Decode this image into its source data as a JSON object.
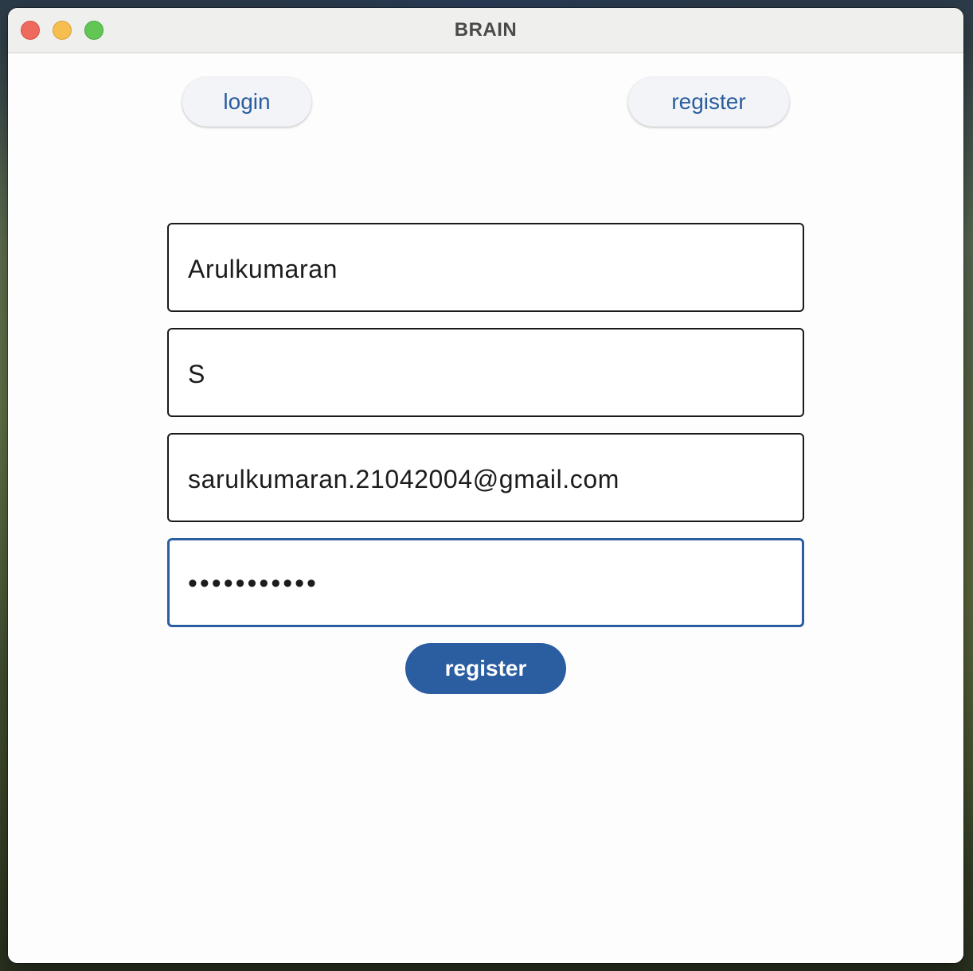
{
  "window": {
    "title": "BRAIN"
  },
  "nav": {
    "login_label": "login",
    "register_label": "register"
  },
  "form": {
    "first_name_value": "Arulkumaran",
    "last_name_value": "S",
    "email_value": "sarulkumaran.21042004@gmail.com",
    "password_masked": "•••••••••••",
    "submit_label": "register"
  },
  "colors": {
    "accent": "#2a5ea1",
    "nav_button_bg": "#f2f4f8",
    "close": "#ee6a5f",
    "minimize": "#f5be4f",
    "maximize": "#62c655"
  }
}
